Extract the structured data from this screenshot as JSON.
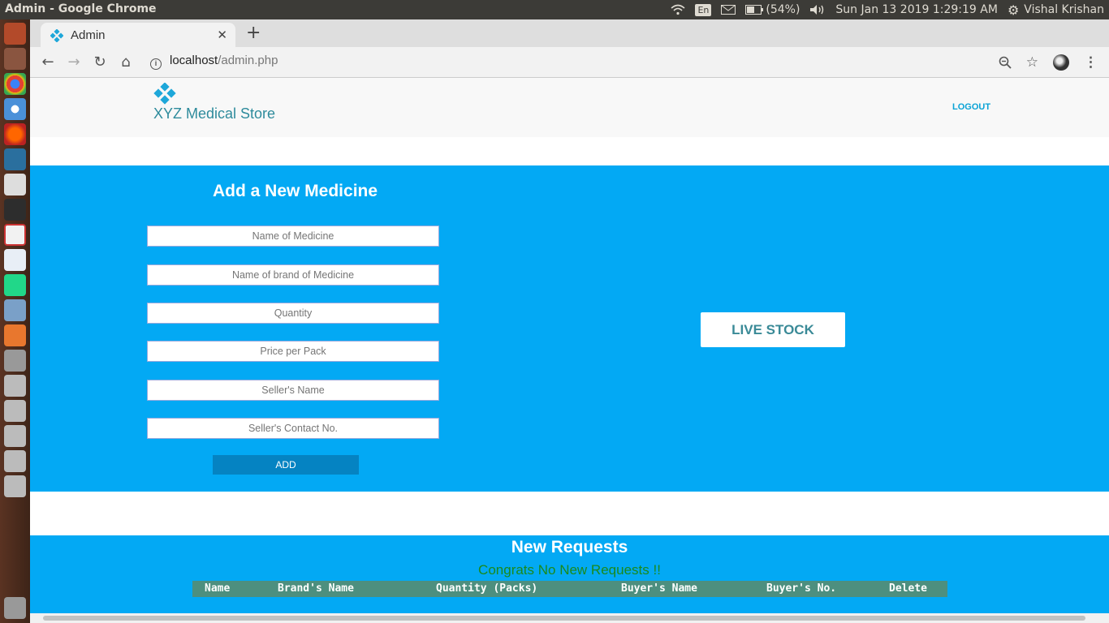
{
  "system_bar": {
    "window_title": "Admin - Google Chrome",
    "lang": "En",
    "battery": "(54%)",
    "datetime": "Sun Jan 13 2019  1:29:19 AM",
    "user": "Vishal Krishan"
  },
  "browser": {
    "tab_title": "Admin",
    "url_host": "localhost",
    "url_path": "/admin.php"
  },
  "navbar": {
    "brand": "XYZ Medical Store",
    "logout": "LOGOUT"
  },
  "add_form": {
    "title": "Add a New Medicine",
    "fields": [
      {
        "placeholder": "Name of Medicine"
      },
      {
        "placeholder": "Name of brand of Medicine"
      },
      {
        "placeholder": "Quantity"
      },
      {
        "placeholder": "Price per Pack"
      },
      {
        "placeholder": "Seller's Name"
      },
      {
        "placeholder": "Seller's Contact No."
      }
    ],
    "submit": "ADD"
  },
  "live_stock": "LIVE STOCK",
  "requests": {
    "title": "New Requests",
    "message": "Congrats No New Requests !!",
    "columns": [
      "Name",
      "Brand's Name",
      "Quantity (Packs)",
      "Buyer's Name",
      "Buyer's No.",
      "Delete"
    ]
  },
  "colors": {
    "accent_blue": "#03a9f4",
    "table_header": "#4d8f7f",
    "success_text": "#1b8a1b"
  }
}
